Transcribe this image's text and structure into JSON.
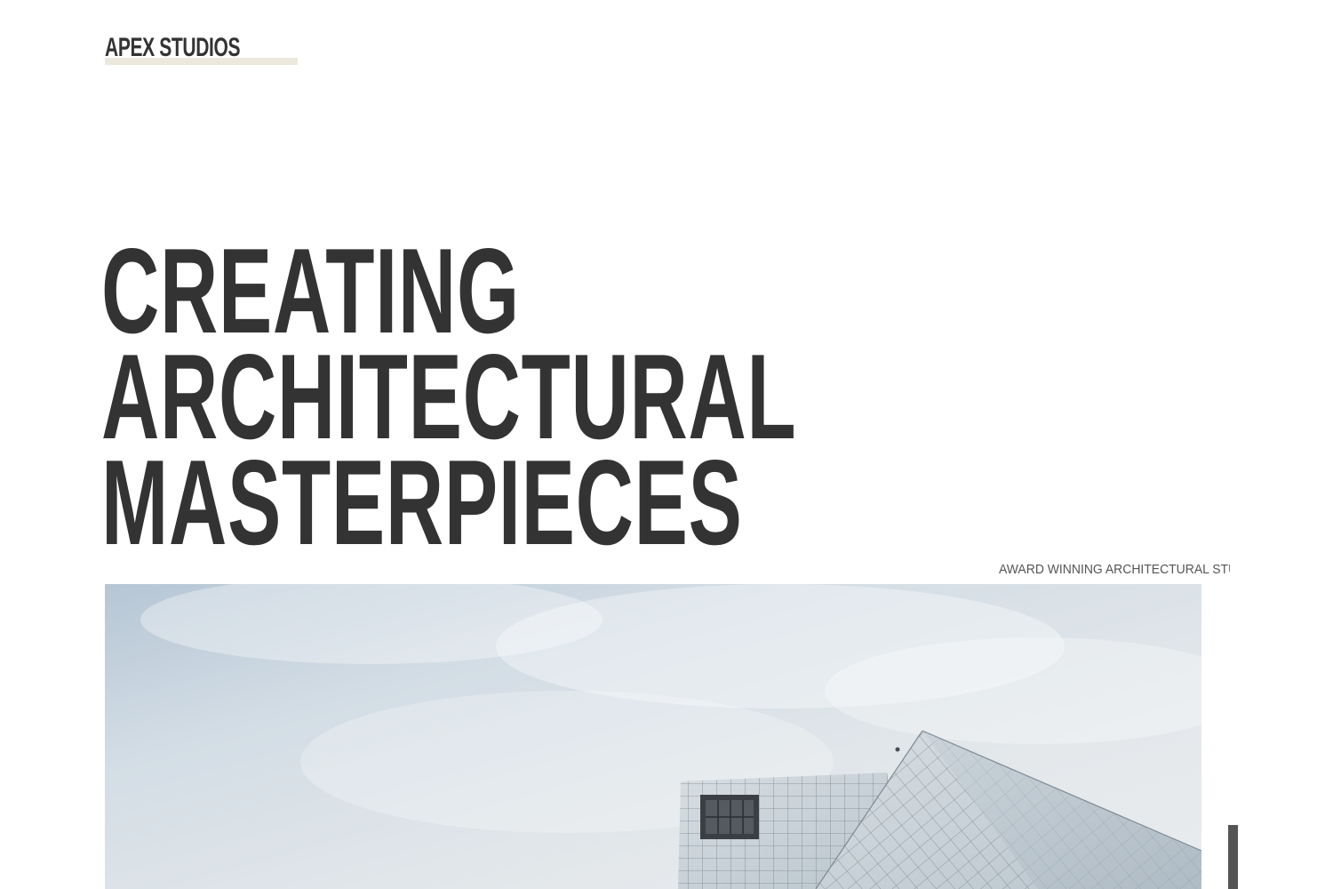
{
  "brand": {
    "name": "APEX STUDIOS"
  },
  "hero": {
    "headline_lines": [
      "CREATING",
      "ARCHITECTURAL",
      "MASTERPIECES"
    ],
    "tagline": "AWARD WINNING ARCHITECTURAL STU",
    "image_subject": "modern-building-photo"
  },
  "colors": {
    "text": "#333333",
    "logo_highlight": "#ece8dc",
    "tagline": "#555555",
    "background": "#ffffff",
    "scroll_indicator": "#555555"
  }
}
